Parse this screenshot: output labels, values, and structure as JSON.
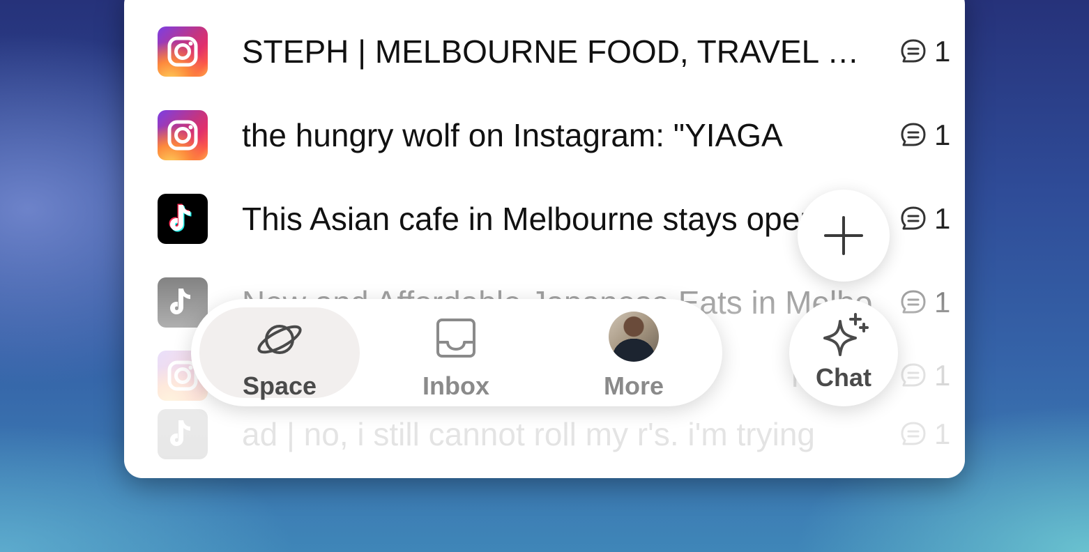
{
  "list": {
    "items": [
      {
        "app": "instagram",
        "icon": "instagram-icon",
        "title": "STEPH | MELBOURNE FOOD, TRAVEL & LIFESTYLE",
        "count": "1"
      },
      {
        "app": "instagram",
        "icon": "instagram-icon",
        "title": "the hungry wolf on Instagram: \"YIAGA",
        "count": "1"
      },
      {
        "app": "tiktok",
        "icon": "tiktok-icon",
        "title": "This Asian cafe in Melbourne stays open",
        "count": "1"
      },
      {
        "app": "tiktok",
        "icon": "tiktok-icon",
        "title": "New and Affordable Japanese Eats in Melbourne",
        "count": "1"
      },
      {
        "app": "instagram",
        "icon": "instagram-icon",
        "title": "named",
        "count": "1"
      },
      {
        "app": "tiktok",
        "icon": "tiktok-icon",
        "title": "ad | no, i still cannot roll my r's. i'm trying",
        "count": "1"
      }
    ]
  },
  "nav": {
    "space_label": "Space",
    "inbox_label": "Inbox",
    "more_label": "More",
    "space_icon": "planet-icon",
    "inbox_icon": "inbox-tray-icon"
  },
  "fab": {
    "icon": "plus-icon"
  },
  "chat": {
    "label": "Chat",
    "icon": "sparkle-icon"
  }
}
